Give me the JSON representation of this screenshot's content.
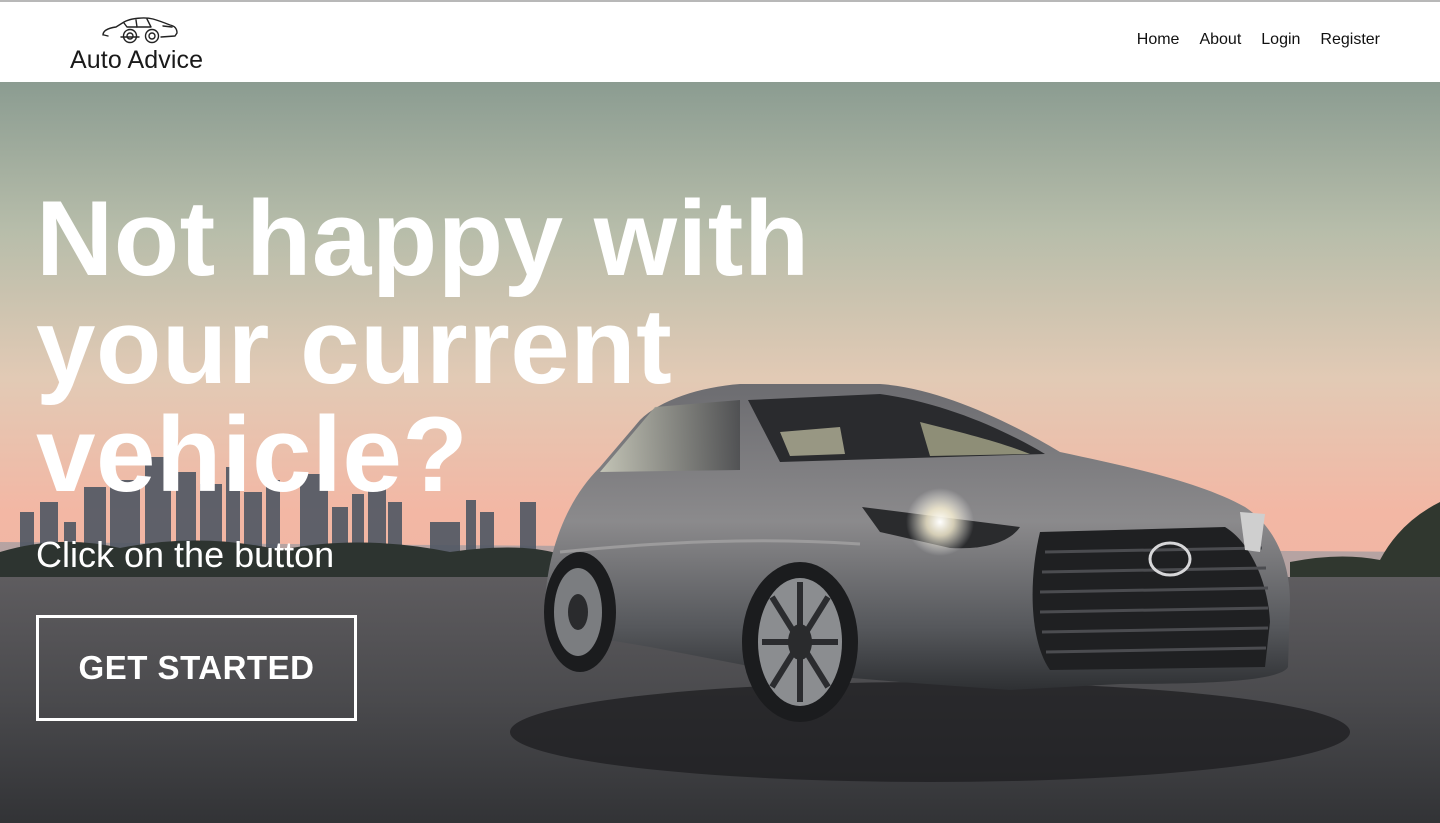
{
  "brand": {
    "name": "Auto Advice",
    "logo_icon": "car-outline-icon"
  },
  "nav": {
    "links": [
      {
        "label": "Home"
      },
      {
        "label": "About"
      },
      {
        "label": "Login"
      },
      {
        "label": "Register"
      }
    ]
  },
  "hero": {
    "title": "Not happy with your current vehicle?",
    "subtitle": "Click on the button",
    "cta_label": "GET STARTED",
    "background": "sedan-at-sunset-city-skyline-photo"
  },
  "colors": {
    "nav_bg": "#ffffff",
    "hero_text": "#ffffff",
    "sky_top": "#8f9f94",
    "sky_glow": "#f2bba7",
    "ground": "#4b4c4f"
  }
}
